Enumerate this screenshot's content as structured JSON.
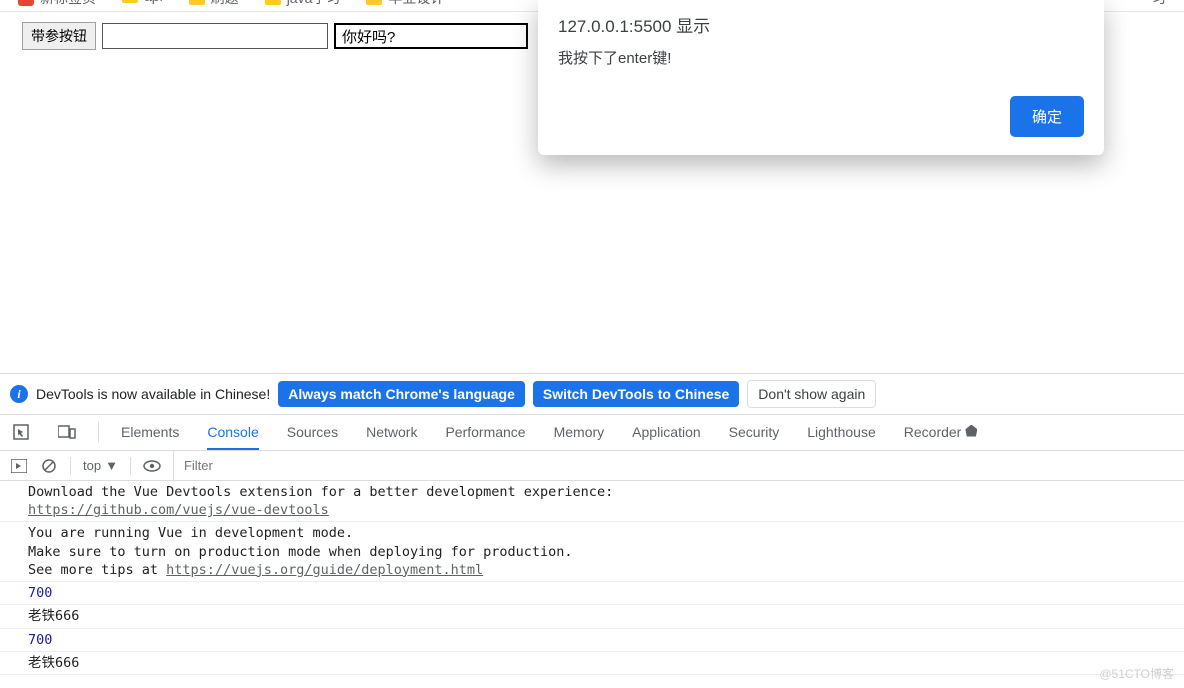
{
  "bookmarks": [
    "新标签页",
    "api",
    "刷题",
    "java学习",
    "毕业设计",
    "习"
  ],
  "page": {
    "button_label": "带参按钮",
    "input1_value": "",
    "input2_value": "你好吗?"
  },
  "alert": {
    "title": "127.0.0.1:5500 显示",
    "message": "我按下了enter键!",
    "ok_label": "确定"
  },
  "banner": {
    "text": "DevTools is now available in Chinese!",
    "btn_match": "Always match Chrome's language",
    "btn_switch": "Switch DevTools to Chinese",
    "btn_dont": "Don't show again"
  },
  "tabs": [
    "Elements",
    "Console",
    "Sources",
    "Network",
    "Performance",
    "Memory",
    "Application",
    "Security",
    "Lighthouse",
    "Recorder"
  ],
  "active_tab": "Console",
  "toolbar": {
    "top_label": "top",
    "filter_placeholder": "Filter"
  },
  "console": {
    "msg1_line1": "Download the Vue Devtools extension for a better development experience:",
    "msg1_link": "https://github.com/vuejs/vue-devtools",
    "msg2_line1": "You are running Vue in development mode.",
    "msg2_line2": "Make sure to turn on production mode when deploying for production.",
    "msg2_line3_prefix": "See more tips at ",
    "msg2_link": "https://vuejs.org/guide/deployment.html",
    "num1": "700",
    "str1": "老铁666",
    "num2": "700",
    "str2": "老铁666"
  },
  "watermark": "@51CTO博客"
}
